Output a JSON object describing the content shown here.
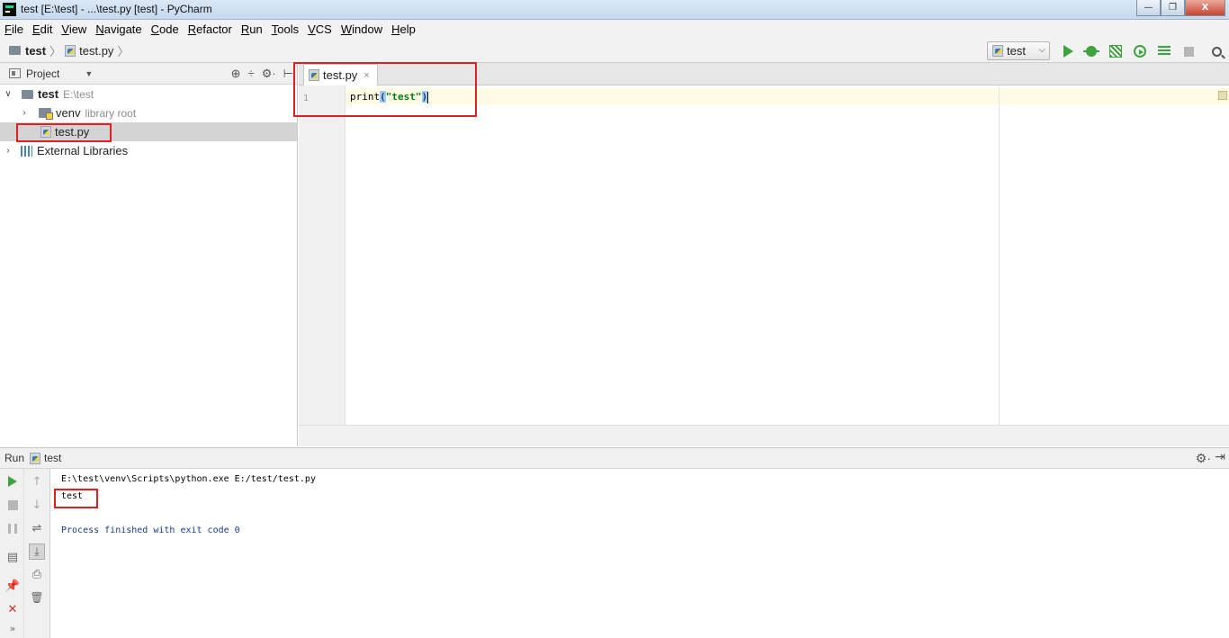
{
  "window": {
    "title": "test [E:\\test] - ...\\test.py [test] - PyCharm",
    "minimize": "—",
    "maximize": "❐",
    "close": "X"
  },
  "menu": [
    {
      "label": "File",
      "u": "F",
      "rest": "ile"
    },
    {
      "label": "Edit",
      "u": "E",
      "rest": "dit"
    },
    {
      "label": "View",
      "u": "V",
      "rest": "iew"
    },
    {
      "label": "Navigate",
      "u": "N",
      "rest": "avigate"
    },
    {
      "label": "Code",
      "u": "C",
      "rest": "ode"
    },
    {
      "label": "Refactor",
      "u": "R",
      "rest": "efactor"
    },
    {
      "label": "Run",
      "u": "R",
      "rest": "un"
    },
    {
      "label": "Tools",
      "u": "T",
      "rest": "ools"
    },
    {
      "label": "VCS",
      "u": "V",
      "rest": "CS"
    },
    {
      "label": "Window",
      "u": "W",
      "rest": "indow"
    },
    {
      "label": "Help",
      "u": "H",
      "rest": "elp"
    }
  ],
  "breadcrumb": {
    "project": "test",
    "file": "test.py",
    "sep": "〉"
  },
  "run_config": {
    "selected": "test",
    "chevron": "⌵"
  },
  "project_panel": {
    "title": "Project",
    "dropdown": "▼",
    "tools": [
      "⊕",
      "÷",
      "⚙·",
      "⊢"
    ],
    "tree": {
      "root_name": "test",
      "root_path": "E:\\test",
      "venv_name": "venv",
      "venv_note": "library root",
      "file_name": "test.py",
      "ext_libs": "External Libraries",
      "collapse_arrow": "∨",
      "expand_arrow": "›"
    }
  },
  "editor": {
    "tab_label": "test.py",
    "tab_close": "×",
    "line_number": "1",
    "code": {
      "fn": "print",
      "open": "(",
      "string": "\"test\"",
      "close": ")"
    }
  },
  "run_panel": {
    "label": "Run",
    "config": "test",
    "gear": "⚙·",
    "minimize": "⇥",
    "console": {
      "command": "E:\\test\\venv\\Scripts\\python.exe E:/test/test.py",
      "output": "test",
      "exit": "Process finished with exit code 0"
    },
    "tool_glyphs": {
      "up": "↑",
      "down": "↓",
      "wrap": "⇌",
      "scroll_end": "⤓",
      "print": "⎙",
      "trash": "🗑",
      "layout": "▤",
      "pin": "📌",
      "close": "✕",
      "more": "»"
    }
  },
  "colors": {
    "highlight": "#e02020",
    "run_green": "#3ea33e",
    "string_green": "#067d17",
    "exit_blue": "#1a3a8c"
  }
}
